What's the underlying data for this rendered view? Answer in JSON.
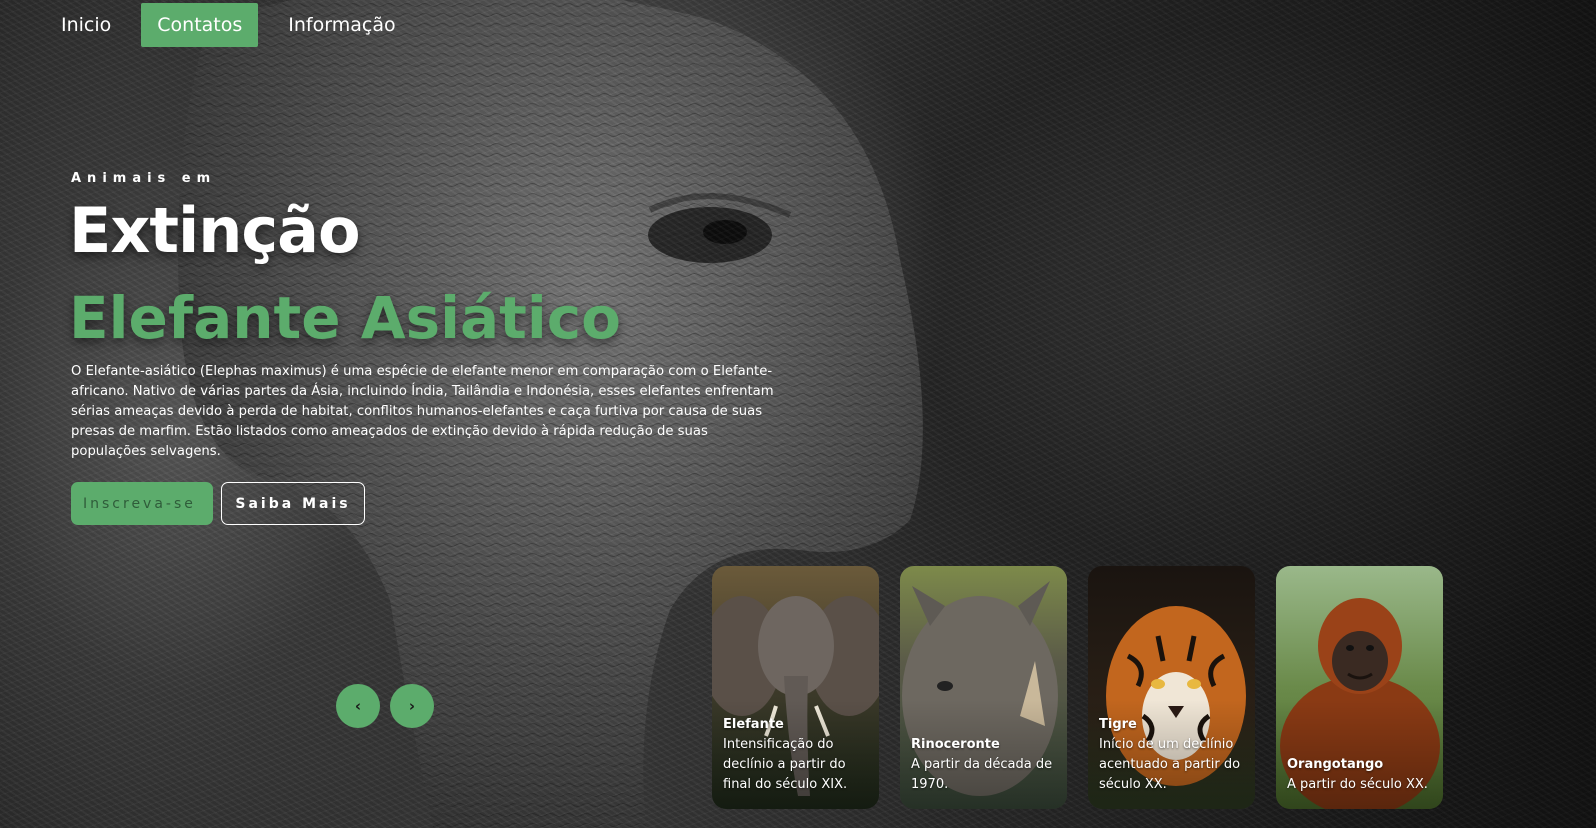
{
  "nav": {
    "items": [
      {
        "label": "Inicio",
        "active": false
      },
      {
        "label": "Contatos",
        "active": true
      },
      {
        "label": "Informação",
        "active": false
      }
    ]
  },
  "hero": {
    "eyebrow": "Animais em",
    "title": "Extinção",
    "subtitle": "Elefante Asiático",
    "description": "O Elefante-asiático (Elephas maximus) é uma espécie de elefante menor em comparação com o Elefante-africano. Nativo de várias partes da Ásia, incluindo Índia, Tailândia e Indonésia, esses elefantes enfrentam sérias ameaças devido à perda de habitat, conflitos humanos-elefantes e caça furtiva por causa de suas presas de marfim. Estão listados como ameaçados de extinção devido à rápida redução de suas populações selvagens.",
    "primary_button": "Inscreva-se",
    "secondary_button": "Saiba Mais"
  },
  "carousel": {
    "prev_icon": "‹",
    "next_icon": "›",
    "cards": [
      {
        "name": "Elefante",
        "text": "Intensificação do declínio a partir do final do século XIX."
      },
      {
        "name": "Rinoceronte",
        "text": "A partir da década de 1970."
      },
      {
        "name": "Tigre",
        "text": "Início de um declínio acentuado a partir do século XX."
      },
      {
        "name": "Orangotango",
        "text": "A partir do século XX."
      }
    ]
  },
  "colors": {
    "accent": "#5cac6c",
    "background": "#2a2a2a"
  }
}
